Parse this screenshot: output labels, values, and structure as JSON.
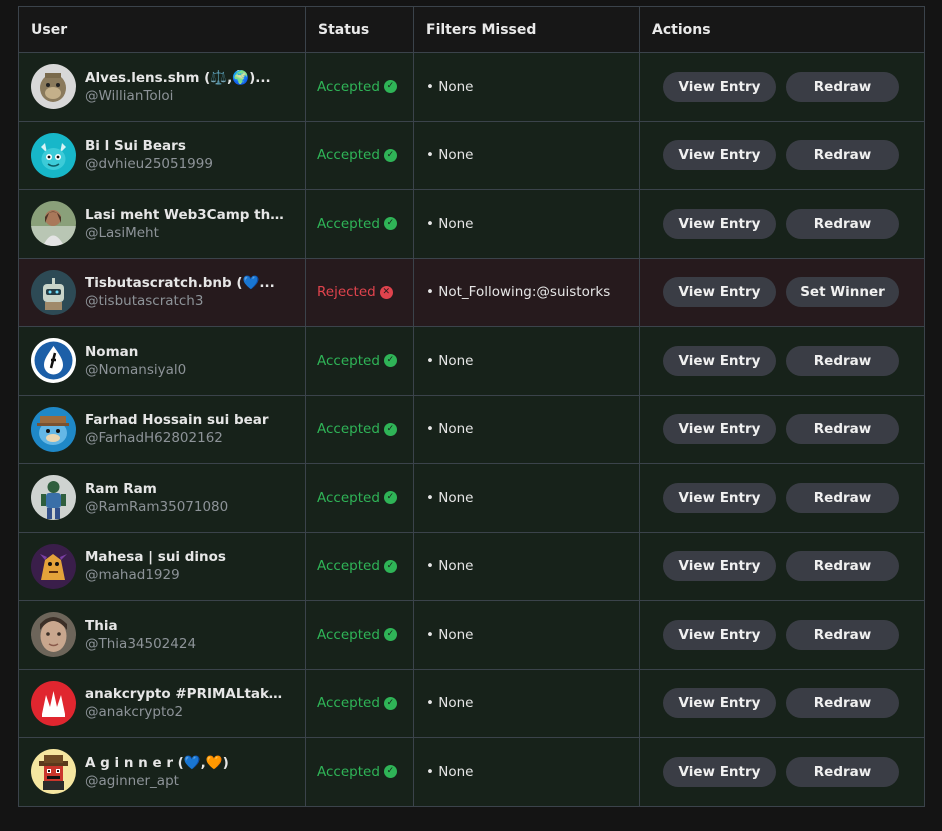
{
  "headers": {
    "user": "User",
    "status": "Status",
    "filters": "Filters Missed",
    "actions": "Actions"
  },
  "colors": {
    "accepted": "#2fb457",
    "rejected": "#e0434d",
    "button_bg": "#3a3d45",
    "row_bg": "#17221a",
    "row_rejected_bg": "#261a1d"
  },
  "rows": [
    {
      "name": "Alves.lens.shm (⚖️,🌍)...",
      "handle": "@WillianToloi",
      "status": "Accepted",
      "status_icon": "check-circle-icon",
      "filters": "• None",
      "primary_action": "View Entry",
      "secondary_action": "Redraw",
      "avatar": "ape-avatar"
    },
    {
      "name": "Bi l Sui Bears",
      "handle": "@dvhieu25051999",
      "status": "Accepted",
      "status_icon": "check-circle-icon",
      "filters": "• None",
      "primary_action": "View Entry",
      "secondary_action": "Redraw",
      "avatar": "cyan-creature-avatar"
    },
    {
      "name": "Lasi meht Web3Camp tha...",
      "handle": "@LasiMeht",
      "status": "Accepted",
      "status_icon": "check-circle-icon",
      "filters": "• None",
      "primary_action": "View Entry",
      "secondary_action": "Redraw",
      "avatar": "photo-avatar"
    },
    {
      "name": "Tisbutascratch.bnb (💙...",
      "handle": "@tisbutascratch3",
      "status": "Rejected",
      "status_icon": "x-circle-icon",
      "filters": "• Not_Following:@suistorks",
      "primary_action": "View Entry",
      "secondary_action": "Set Winner",
      "avatar": "robot-avatar"
    },
    {
      "name": "Noman",
      "handle": "@Nomansiyal0",
      "status": "Accepted",
      "status_icon": "check-circle-icon",
      "filters": "• None",
      "primary_action": "View Entry",
      "secondary_action": "Redraw",
      "avatar": "sui-drop-avatar"
    },
    {
      "name": "Farhad Hossain sui bear",
      "handle": "@FarhadH62802162",
      "status": "Accepted",
      "status_icon": "check-circle-icon",
      "filters": "• None",
      "primary_action": "View Entry",
      "secondary_action": "Redraw",
      "avatar": "blue-bear-avatar"
    },
    {
      "name": "Ram Ram",
      "handle": "@RamRam35071080",
      "status": "Accepted",
      "status_icon": "check-circle-icon",
      "filters": "• None",
      "primary_action": "View Entry",
      "secondary_action": "Redraw",
      "avatar": "figure-avatar"
    },
    {
      "name": "Mahesa | sui dinos",
      "handle": "@mahad1929",
      "status": "Accepted",
      "status_icon": "check-circle-icon",
      "filters": "• None",
      "primary_action": "View Entry",
      "secondary_action": "Redraw",
      "avatar": "purple-dino-avatar"
    },
    {
      "name": "Thia",
      "handle": "@Thia34502424",
      "status": "Accepted",
      "status_icon": "check-circle-icon",
      "filters": "• None",
      "primary_action": "View Entry",
      "secondary_action": "Redraw",
      "avatar": "face-avatar"
    },
    {
      "name": "anakcrypto #PRIMALtake...",
      "handle": "@anakcrypto2",
      "status": "Accepted",
      "status_icon": "check-circle-icon",
      "filters": "• None",
      "primary_action": "View Entry",
      "secondary_action": "Redraw",
      "avatar": "red-logo-avatar"
    },
    {
      "name": "A g i n n e r (💙,🧡)",
      "handle": "@aginner_apt",
      "status": "Accepted",
      "status_icon": "check-circle-icon",
      "filters": "• None",
      "primary_action": "View Entry",
      "secondary_action": "Redraw",
      "avatar": "pixel-ranger-avatar"
    }
  ]
}
